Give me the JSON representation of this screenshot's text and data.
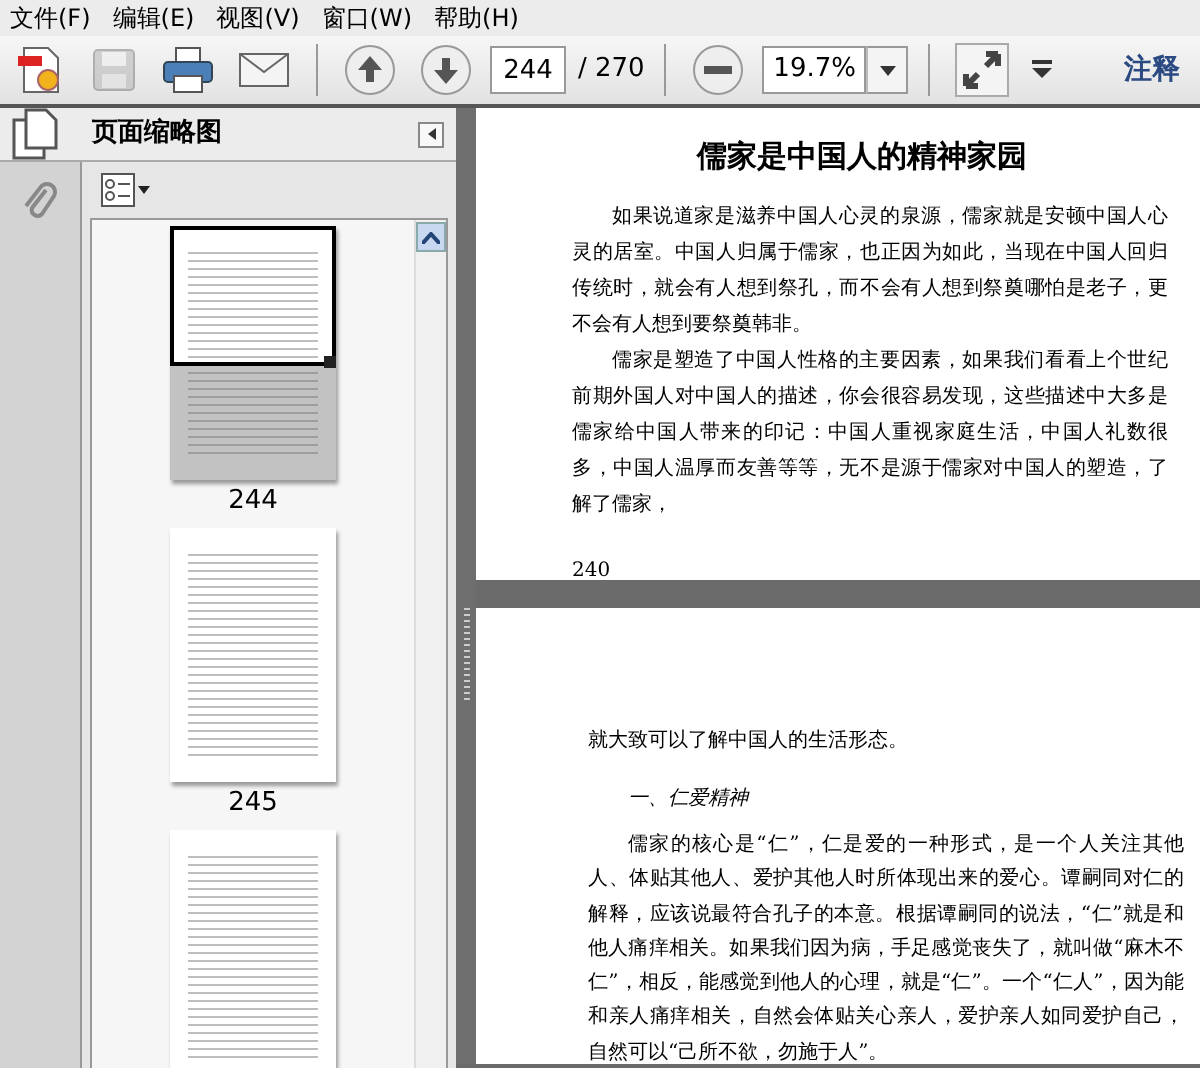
{
  "menu": [
    {
      "label": "文件(F)"
    },
    {
      "label": "编辑(E)"
    },
    {
      "label": "视图(V)"
    },
    {
      "label": "窗口(W)"
    },
    {
      "label": "帮助(H)"
    }
  ],
  "toolbar": {
    "page_number": "244",
    "page_total": "/ 270",
    "zoom": "19.7%",
    "comment_button": "注释",
    "save_disabled": true
  },
  "panel": {
    "title": "页面缩略图",
    "thumbnails": [
      {
        "label": "244",
        "selected": true
      },
      {
        "label": "245",
        "selected": false
      },
      {
        "selected": false
      }
    ]
  },
  "pages": [
    {
      "blocks": [
        {
          "kind": "title",
          "text": "儒家是中国人的精神家园"
        },
        {
          "kind": "paragraph",
          "text": "如果说道家是滋养中国人心灵的泉源，儒家就是安顿中国人心灵的居室。中国人归属于儒家，也正因为如此，当现在中国人回归传统时，就会有人想到祭孔，而不会有人想到祭奠哪怕是老子，更不会有人想到要祭奠韩非。"
        },
        {
          "kind": "paragraph",
          "text": "儒家是塑造了中国人性格的主要因素，如果我们看看上个世纪前期外国人对中国人的描述，你会很容易发现，这些描述中大多是儒家给中国人带来的印记：中国人重视家庭生活，中国人礼数很多，中国人温厚而友善等等，无不是源于儒家对中国人的塑造，了解了儒家，"
        },
        {
          "kind": "folio",
          "text": "240"
        }
      ]
    },
    {
      "blocks": [
        {
          "kind": "continuation",
          "text": "就大致可以了解中国人的生活形态。"
        },
        {
          "kind": "heading",
          "text": "一、仁爱精神"
        },
        {
          "kind": "paragraph",
          "text": "儒家的核心是“仁”，仁是爱的一种形式，是一个人关注其他人、体贴其他人、爱护其他人时所体现出来的爱心。谭嗣同对仁的解释，应该说最符合孔子的本意。根据谭嗣同的说法，“仁”就是和他人痛痒相关。如果我们因为病，手足感觉丧失了，就叫做“麻木不仁”，相反，能感觉到他人的心理，就是“仁”。一个“仁人”，因为能和亲人痛痒相关，自然会体贴关心亲人，爱护亲人如同爱护自己，自然可以“己所不欲，勿施于人”。"
        }
      ]
    }
  ]
}
